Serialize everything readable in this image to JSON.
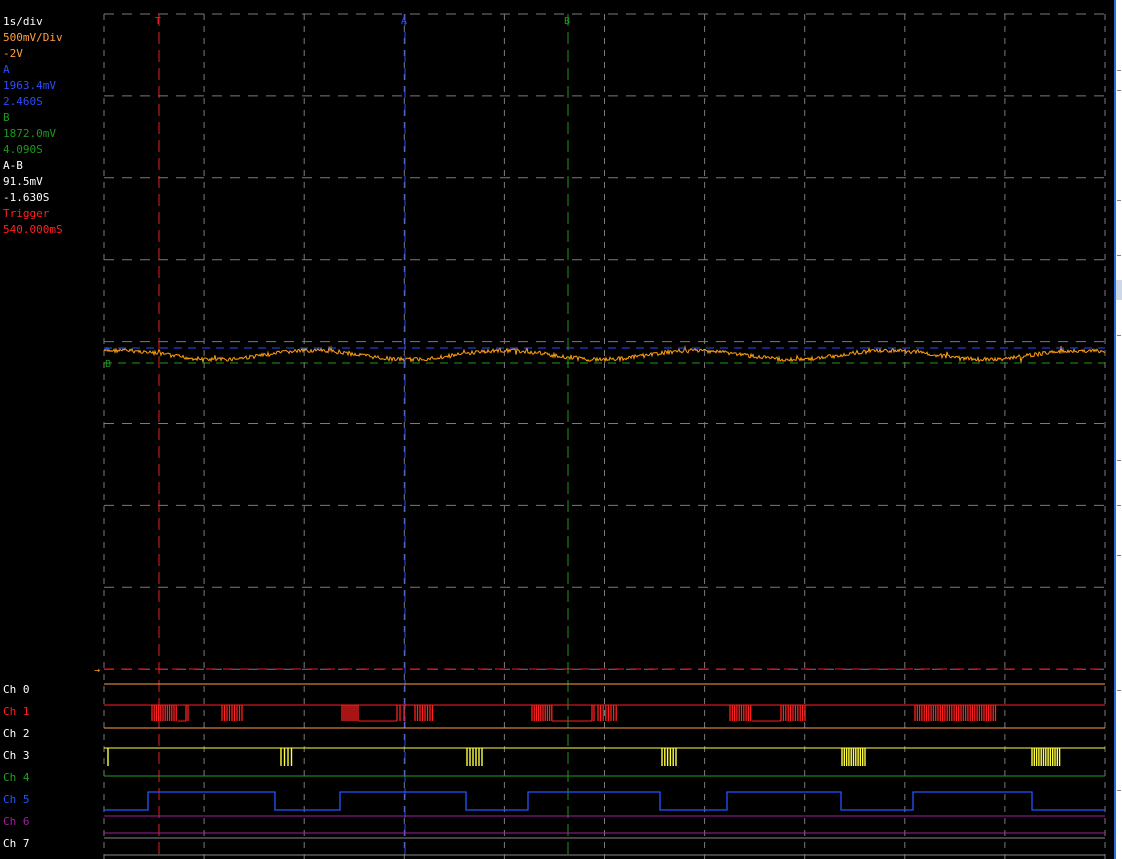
{
  "readout": {
    "timebase": "1s/div",
    "volts_per_div": "500mV/Div",
    "offset": "-2V",
    "cursor_a_label": "A",
    "cursor_a_voltage": "1963.4mV",
    "cursor_a_time": "2.460S",
    "cursor_b_label": "B",
    "cursor_b_voltage": "1872.0mV",
    "cursor_b_time": "4.090S",
    "delta_label": "A-B",
    "delta_voltage": "91.5mV",
    "delta_time": "-1.630S",
    "trigger_label": "Trigger",
    "trigger_time": "540.000mS"
  },
  "cursors": {
    "trigger_marker": "T",
    "a_marker": "A",
    "b_marker": "B"
  },
  "channels": [
    {
      "label": "Ch 0",
      "color": "#ffffff"
    },
    {
      "label": "Ch 1",
      "color": "#ff2020"
    },
    {
      "label": "Ch 2",
      "color": "#ffffff"
    },
    {
      "label": "Ch 3",
      "color": "#ffffff"
    },
    {
      "label": "Ch 4",
      "color": "#22a022"
    },
    {
      "label": "Ch 5",
      "color": "#2255ff"
    },
    {
      "label": "Ch 6",
      "color": "#a020a0"
    },
    {
      "label": "Ch 7",
      "color": "#ffffff"
    }
  ],
  "colors": {
    "background": "#000000",
    "grid": "#7a7a7a",
    "analog_trace": "#ffa010",
    "cursor_a": "#2a4dff",
    "cursor_b": "#1c9a1c",
    "trigger": "#e02020",
    "timebase_text": "#ffffff",
    "volts_text": "#ffa040",
    "offset_text": "#ffa040",
    "digital_ch0": "#ffa040",
    "digital_ch1": "#ff2020",
    "digital_ch2": "#ffa040",
    "digital_ch3": "#ffff40",
    "digital_ch4": "#22a022",
    "digital_ch5": "#2255ff",
    "digital_ch6": "#a020a0",
    "digital_ch7": "#888888"
  }
}
